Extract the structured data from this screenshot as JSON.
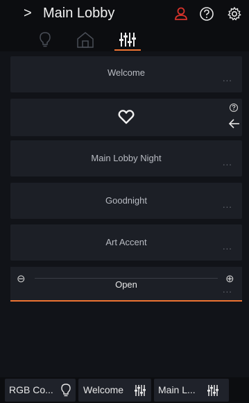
{
  "header": {
    "chevron": ">",
    "title": "Main Lobby",
    "icons": [
      "user-icon",
      "help-icon",
      "settings-icon"
    ],
    "user_icon_color": "#d8332b"
  },
  "tabs": [
    {
      "icon": "lightbulb-icon",
      "selected": false
    },
    {
      "icon": "home-icon",
      "selected": false
    },
    {
      "icon": "sliders-icon",
      "selected": true
    }
  ],
  "scenes": [
    {
      "label": "Welcome",
      "more": "..."
    },
    {
      "label": "",
      "icon": "heart-icon",
      "more": ""
    },
    {
      "label": "Main Lobby Night",
      "more": "..."
    },
    {
      "label": "Goodnight",
      "more": "..."
    },
    {
      "label": "Art Accent",
      "more": "..."
    }
  ],
  "slider": {
    "label": "Open",
    "minus": "⊖",
    "plus": "⊕",
    "more": "..."
  },
  "bottom_bar": [
    {
      "label": "RGB Co...",
      "icon": "lightbulb-icon"
    },
    {
      "label": "Welcome",
      "icon": "sliders-icon"
    },
    {
      "label": "Main L...",
      "icon": "sliders-icon"
    }
  ],
  "colors": {
    "accent": "#ee7433",
    "background": "#111318",
    "card": "#1c1f26"
  }
}
